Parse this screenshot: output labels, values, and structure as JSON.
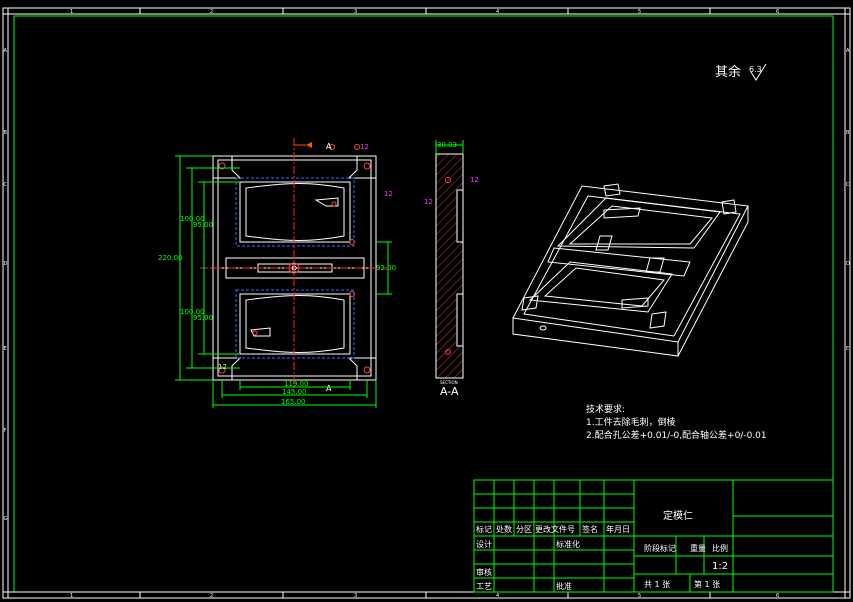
{
  "frame": {
    "col_labels": [
      "1",
      "2",
      "3",
      "4",
      "5",
      "6"
    ],
    "row_labels": [
      "A",
      "B",
      "C",
      "D",
      "E",
      "F",
      "G"
    ]
  },
  "roughness": {
    "text": "其余",
    "value": "6.3"
  },
  "front_view": {
    "section_marker": "A",
    "dims": {
      "overall_height": "220.00",
      "upper_outer": "100.00",
      "upper_inner": "95.00",
      "lower_outer": "100.00",
      "lower_inner": "95.00",
      "center_width": "92.00",
      "width_inner": "119.00",
      "width_mid": "145.00",
      "width_outer": "165.00"
    },
    "tags": [
      "12",
      "12",
      "12"
    ]
  },
  "section_view": {
    "top_dim": "30.03",
    "caption_small": "SECTION",
    "caption": "A-A"
  },
  "tech_notes": {
    "title": "技术要求:",
    "lines": [
      "1.工件去除毛刺，倒棱",
      "2.配合孔公差+0.01/-0,配合轴公差+0/-0.01"
    ]
  },
  "title_block": {
    "part_name": "定模仁",
    "header_labels": [
      "标记",
      "处数",
      "分区",
      "更改文件号",
      "签名",
      "年月日"
    ],
    "design": "设计",
    "standardize": "标准化",
    "review": "审核",
    "process": "工艺",
    "approve": "批准",
    "stage_mark": "阶段标记",
    "weight": "重量",
    "scale": "比例",
    "scale_value": "1:2",
    "total": "共 1  张",
    "sheet": "第 1  张"
  }
}
